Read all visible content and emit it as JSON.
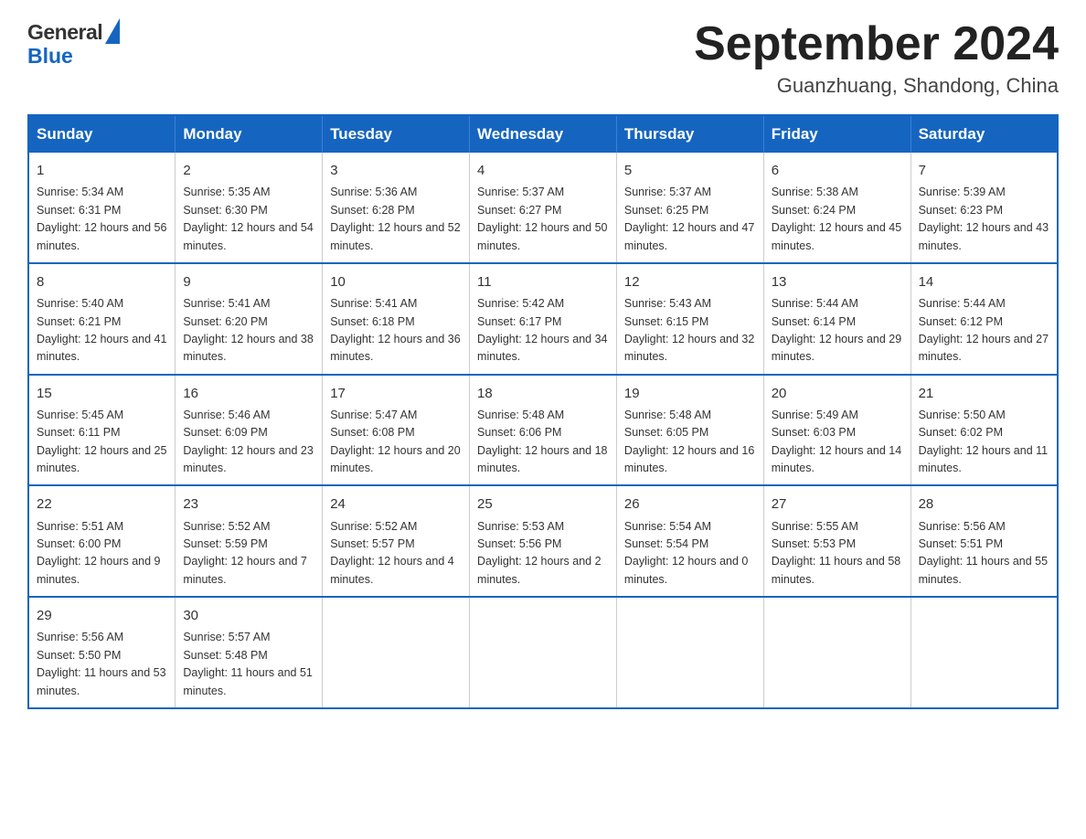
{
  "header": {
    "logo_general": "General",
    "logo_blue": "Blue",
    "month_title": "September 2024",
    "location": "Guanzhuang, Shandong, China"
  },
  "weekdays": [
    "Sunday",
    "Monday",
    "Tuesday",
    "Wednesday",
    "Thursday",
    "Friday",
    "Saturday"
  ],
  "weeks": [
    [
      {
        "day": "1",
        "sunrise": "Sunrise: 5:34 AM",
        "sunset": "Sunset: 6:31 PM",
        "daylight": "Daylight: 12 hours and 56 minutes."
      },
      {
        "day": "2",
        "sunrise": "Sunrise: 5:35 AM",
        "sunset": "Sunset: 6:30 PM",
        "daylight": "Daylight: 12 hours and 54 minutes."
      },
      {
        "day": "3",
        "sunrise": "Sunrise: 5:36 AM",
        "sunset": "Sunset: 6:28 PM",
        "daylight": "Daylight: 12 hours and 52 minutes."
      },
      {
        "day": "4",
        "sunrise": "Sunrise: 5:37 AM",
        "sunset": "Sunset: 6:27 PM",
        "daylight": "Daylight: 12 hours and 50 minutes."
      },
      {
        "day": "5",
        "sunrise": "Sunrise: 5:37 AM",
        "sunset": "Sunset: 6:25 PM",
        "daylight": "Daylight: 12 hours and 47 minutes."
      },
      {
        "day": "6",
        "sunrise": "Sunrise: 5:38 AM",
        "sunset": "Sunset: 6:24 PM",
        "daylight": "Daylight: 12 hours and 45 minutes."
      },
      {
        "day": "7",
        "sunrise": "Sunrise: 5:39 AM",
        "sunset": "Sunset: 6:23 PM",
        "daylight": "Daylight: 12 hours and 43 minutes."
      }
    ],
    [
      {
        "day": "8",
        "sunrise": "Sunrise: 5:40 AM",
        "sunset": "Sunset: 6:21 PM",
        "daylight": "Daylight: 12 hours and 41 minutes."
      },
      {
        "day": "9",
        "sunrise": "Sunrise: 5:41 AM",
        "sunset": "Sunset: 6:20 PM",
        "daylight": "Daylight: 12 hours and 38 minutes."
      },
      {
        "day": "10",
        "sunrise": "Sunrise: 5:41 AM",
        "sunset": "Sunset: 6:18 PM",
        "daylight": "Daylight: 12 hours and 36 minutes."
      },
      {
        "day": "11",
        "sunrise": "Sunrise: 5:42 AM",
        "sunset": "Sunset: 6:17 PM",
        "daylight": "Daylight: 12 hours and 34 minutes."
      },
      {
        "day": "12",
        "sunrise": "Sunrise: 5:43 AM",
        "sunset": "Sunset: 6:15 PM",
        "daylight": "Daylight: 12 hours and 32 minutes."
      },
      {
        "day": "13",
        "sunrise": "Sunrise: 5:44 AM",
        "sunset": "Sunset: 6:14 PM",
        "daylight": "Daylight: 12 hours and 29 minutes."
      },
      {
        "day": "14",
        "sunrise": "Sunrise: 5:44 AM",
        "sunset": "Sunset: 6:12 PM",
        "daylight": "Daylight: 12 hours and 27 minutes."
      }
    ],
    [
      {
        "day": "15",
        "sunrise": "Sunrise: 5:45 AM",
        "sunset": "Sunset: 6:11 PM",
        "daylight": "Daylight: 12 hours and 25 minutes."
      },
      {
        "day": "16",
        "sunrise": "Sunrise: 5:46 AM",
        "sunset": "Sunset: 6:09 PM",
        "daylight": "Daylight: 12 hours and 23 minutes."
      },
      {
        "day": "17",
        "sunrise": "Sunrise: 5:47 AM",
        "sunset": "Sunset: 6:08 PM",
        "daylight": "Daylight: 12 hours and 20 minutes."
      },
      {
        "day": "18",
        "sunrise": "Sunrise: 5:48 AM",
        "sunset": "Sunset: 6:06 PM",
        "daylight": "Daylight: 12 hours and 18 minutes."
      },
      {
        "day": "19",
        "sunrise": "Sunrise: 5:48 AM",
        "sunset": "Sunset: 6:05 PM",
        "daylight": "Daylight: 12 hours and 16 minutes."
      },
      {
        "day": "20",
        "sunrise": "Sunrise: 5:49 AM",
        "sunset": "Sunset: 6:03 PM",
        "daylight": "Daylight: 12 hours and 14 minutes."
      },
      {
        "day": "21",
        "sunrise": "Sunrise: 5:50 AM",
        "sunset": "Sunset: 6:02 PM",
        "daylight": "Daylight: 12 hours and 11 minutes."
      }
    ],
    [
      {
        "day": "22",
        "sunrise": "Sunrise: 5:51 AM",
        "sunset": "Sunset: 6:00 PM",
        "daylight": "Daylight: 12 hours and 9 minutes."
      },
      {
        "day": "23",
        "sunrise": "Sunrise: 5:52 AM",
        "sunset": "Sunset: 5:59 PM",
        "daylight": "Daylight: 12 hours and 7 minutes."
      },
      {
        "day": "24",
        "sunrise": "Sunrise: 5:52 AM",
        "sunset": "Sunset: 5:57 PM",
        "daylight": "Daylight: 12 hours and 4 minutes."
      },
      {
        "day": "25",
        "sunrise": "Sunrise: 5:53 AM",
        "sunset": "Sunset: 5:56 PM",
        "daylight": "Daylight: 12 hours and 2 minutes."
      },
      {
        "day": "26",
        "sunrise": "Sunrise: 5:54 AM",
        "sunset": "Sunset: 5:54 PM",
        "daylight": "Daylight: 12 hours and 0 minutes."
      },
      {
        "day": "27",
        "sunrise": "Sunrise: 5:55 AM",
        "sunset": "Sunset: 5:53 PM",
        "daylight": "Daylight: 11 hours and 58 minutes."
      },
      {
        "day": "28",
        "sunrise": "Sunrise: 5:56 AM",
        "sunset": "Sunset: 5:51 PM",
        "daylight": "Daylight: 11 hours and 55 minutes."
      }
    ],
    [
      {
        "day": "29",
        "sunrise": "Sunrise: 5:56 AM",
        "sunset": "Sunset: 5:50 PM",
        "daylight": "Daylight: 11 hours and 53 minutes."
      },
      {
        "day": "30",
        "sunrise": "Sunrise: 5:57 AM",
        "sunset": "Sunset: 5:48 PM",
        "daylight": "Daylight: 11 hours and 51 minutes."
      },
      null,
      null,
      null,
      null,
      null
    ]
  ]
}
